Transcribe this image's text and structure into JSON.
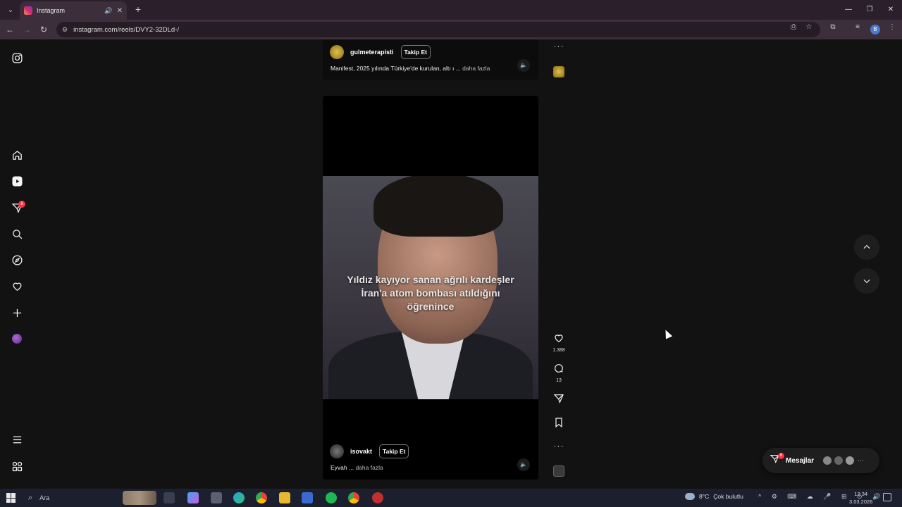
{
  "browser": {
    "tab_title": "Instagram",
    "url": "instagram.com/reels/DVY2-32DLd-/",
    "profile_initial": "B",
    "new_tab_glyph": "+",
    "window_controls": [
      "—",
      "❐",
      "✕"
    ]
  },
  "nav": {
    "notif_count": "8",
    "items": [
      "instagram-logo",
      "home",
      "reels",
      "messages",
      "search",
      "explore",
      "notifications",
      "create",
      "profile",
      "more",
      "also-from-meta"
    ]
  },
  "reel_top": {
    "username": "gulmeterapisti",
    "follow_label": "Takip Et",
    "caption": "Manifest, 2025 yılında Türkiye'de kurulan, altı ı ...",
    "more_label": "daha fazla"
  },
  "reel_main": {
    "subtitle": "Yıldız kayıyor sanan ağrılı kardeşler İran'a atom bombası atıldığını öğrenince",
    "username": "isovakt",
    "follow_label": "Takip Et",
    "caption": "Eyvah ...",
    "more_label": "daha fazla"
  },
  "actions": {
    "likes": "1.388",
    "comments": "13"
  },
  "messages": {
    "label": "Mesajlar",
    "badge": "8"
  },
  "taskbar": {
    "search_placeholder": "Ara",
    "temperature": "8°C",
    "weather_text": "Çok bulutlu",
    "time": "12:34",
    "date": "3.03.2026"
  },
  "colors": {
    "badge": "#ff3040",
    "background": "#121212",
    "chrome": "#3c2f3b"
  }
}
